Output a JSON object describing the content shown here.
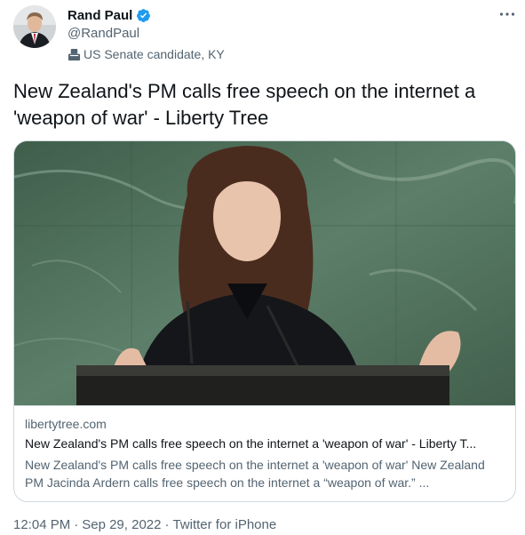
{
  "author": {
    "display_name": "Rand Paul",
    "handle": "@RandPaul",
    "verified_icon": "verified-badge-icon",
    "label": "US Senate candidate, KY",
    "label_icon": "ballot-box-icon"
  },
  "more_icon": "more-horizontal-icon",
  "tweet": {
    "text": "New Zealand's PM calls free speech on the internet a 'weapon of war' - Liberty Tree"
  },
  "card": {
    "domain": "libertytree.com",
    "title": "New Zealand's PM calls free speech on the internet a 'weapon of war' - Liberty T...",
    "description": "New Zealand's PM calls free speech on the internet a 'weapon of war' New Zealand PM Jacinda Ardern calls free speech on the internet a “weapon of war.” ..."
  },
  "meta": {
    "time": "12:04 PM",
    "separator": "·",
    "date": "Sep 29, 2022",
    "source": "Twitter for iPhone"
  },
  "colors": {
    "verified": "#1d9bf0",
    "secondary_text": "#536471",
    "primary_text": "#0f1419",
    "border": "#cfd9de"
  }
}
